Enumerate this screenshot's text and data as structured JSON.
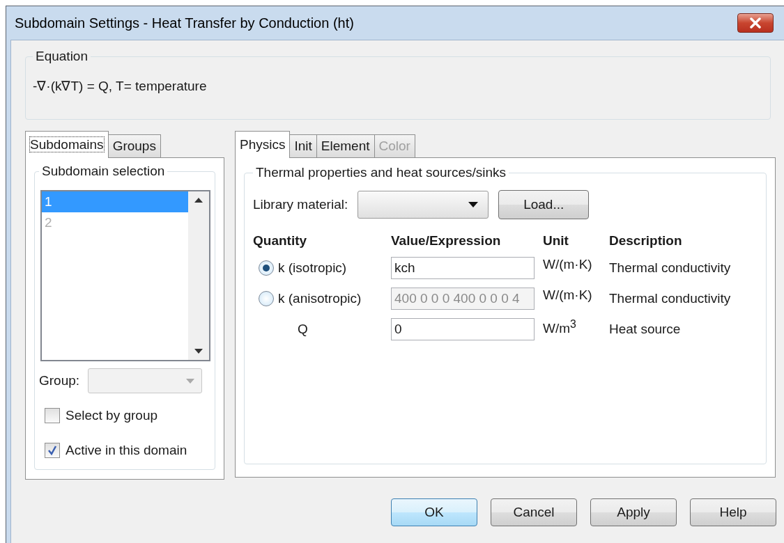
{
  "window": {
    "title": "Subdomain Settings - Heat Transfer by Conduction (ht)"
  },
  "equation": {
    "label": "Equation",
    "text": "-∇·(k∇T) = Q, T= temperature"
  },
  "left_tabs": [
    {
      "label": "Subdomains",
      "selected": true
    },
    {
      "label": "Groups",
      "selected": false
    }
  ],
  "subdomain_selection": {
    "label": "Subdomain selection",
    "items": [
      {
        "label": "1",
        "selected": true,
        "disabled": false
      },
      {
        "label": "2",
        "selected": false,
        "disabled": true
      }
    ]
  },
  "group": {
    "label": "Group:"
  },
  "checkboxes": [
    {
      "label": "Select by group",
      "checked": false
    },
    {
      "label": "Active in this domain",
      "checked": true
    }
  ],
  "right_tabs": [
    {
      "label": "Physics",
      "selected": true,
      "disabled": false
    },
    {
      "label": "Init",
      "selected": false,
      "disabled": false
    },
    {
      "label": "Element",
      "selected": false,
      "disabled": false
    },
    {
      "label": "Color",
      "selected": false,
      "disabled": true
    }
  ],
  "physics": {
    "label": "Thermal properties and heat sources/sinks",
    "library_label": "Library material:",
    "load_button": "Load...",
    "columns": [
      "Quantity",
      "Value/Expression",
      "Unit",
      "Description"
    ],
    "rows": [
      {
        "kind": "radio",
        "selected": true,
        "quantity": "k (isotropic)",
        "value": "kch",
        "disabled": false,
        "unit": "W/(m·K)",
        "description": "Thermal conductivity"
      },
      {
        "kind": "radio",
        "selected": false,
        "quantity": "k (anisotropic)",
        "value": "400 0 0 0 400 0 0 0 4",
        "disabled": true,
        "unit": "W/(m·K)",
        "description": "Thermal conductivity"
      },
      {
        "kind": "plain",
        "quantity": "Q",
        "value": "0",
        "disabled": false,
        "unit": "W/m$^{3}$",
        "description": "Heat source"
      }
    ]
  },
  "buttons": [
    {
      "label": "OK",
      "default": true
    },
    {
      "label": "Cancel",
      "default": false
    },
    {
      "label": "Apply",
      "default": false
    },
    {
      "label": "Help",
      "default": false
    }
  ]
}
